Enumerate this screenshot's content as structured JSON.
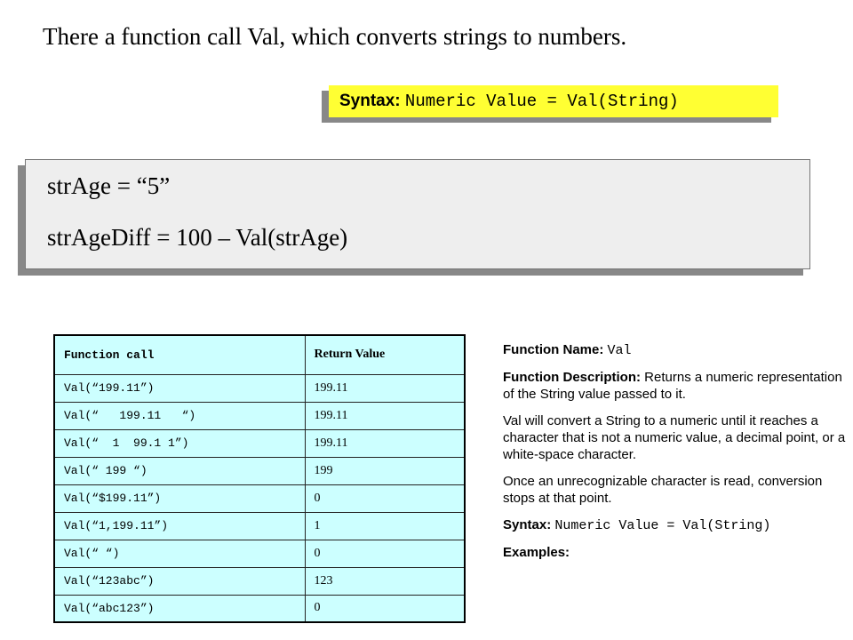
{
  "title": "There a function call Val, which converts strings to numbers.",
  "syntax_box": {
    "label": "Syntax:",
    "code": "Numeric Value = Val(String)"
  },
  "code_example": {
    "line1": "strAge = “5”",
    "line2": "strAgeDiff  = 100 – Val(strAge)"
  },
  "table": {
    "headers": [
      "Function call",
      "Return Value"
    ],
    "rows": [
      {
        "call": "Val(“199.11”)",
        "value": "199.11"
      },
      {
        "call": "Val(“   199.11   “)",
        "value": "199.11"
      },
      {
        "call": "Val(“  1  99.1 1”)",
        "value": "199.11"
      },
      {
        "call": "Val(“ 199 “)",
        "value": "199"
      },
      {
        "call": "Val(“$199.11”)",
        "value": "0"
      },
      {
        "call": "Val(“1,199.11”)",
        "value": "1"
      },
      {
        "call": "Val(“ “)",
        "value": "0"
      },
      {
        "call": "Val(“123abc”)",
        "value": "123"
      },
      {
        "call": "Val(“abc123”)",
        "value": "0"
      }
    ]
  },
  "description": {
    "name_label": "Function Name:",
    "name_value": "Val",
    "desc_label": "Function Description:",
    "desc_text": "Returns a numeric representation of the String value passed to it.",
    "para1": "Val will convert a String to a numeric until it reaches a character that is not a numeric value, a decimal point, or a white-space character.",
    "para2": "Once an unrecognizable character is read, conversion stops at that point.",
    "syntax_label": "Syntax:",
    "syntax_code": "Numeric Value = Val(String)",
    "examples_label": "Examples:"
  },
  "colors": {
    "syntax_highlight": "#ffff33",
    "table_cell": "#ccffff",
    "code_box": "#eeeeee",
    "shadow": "#888888"
  }
}
